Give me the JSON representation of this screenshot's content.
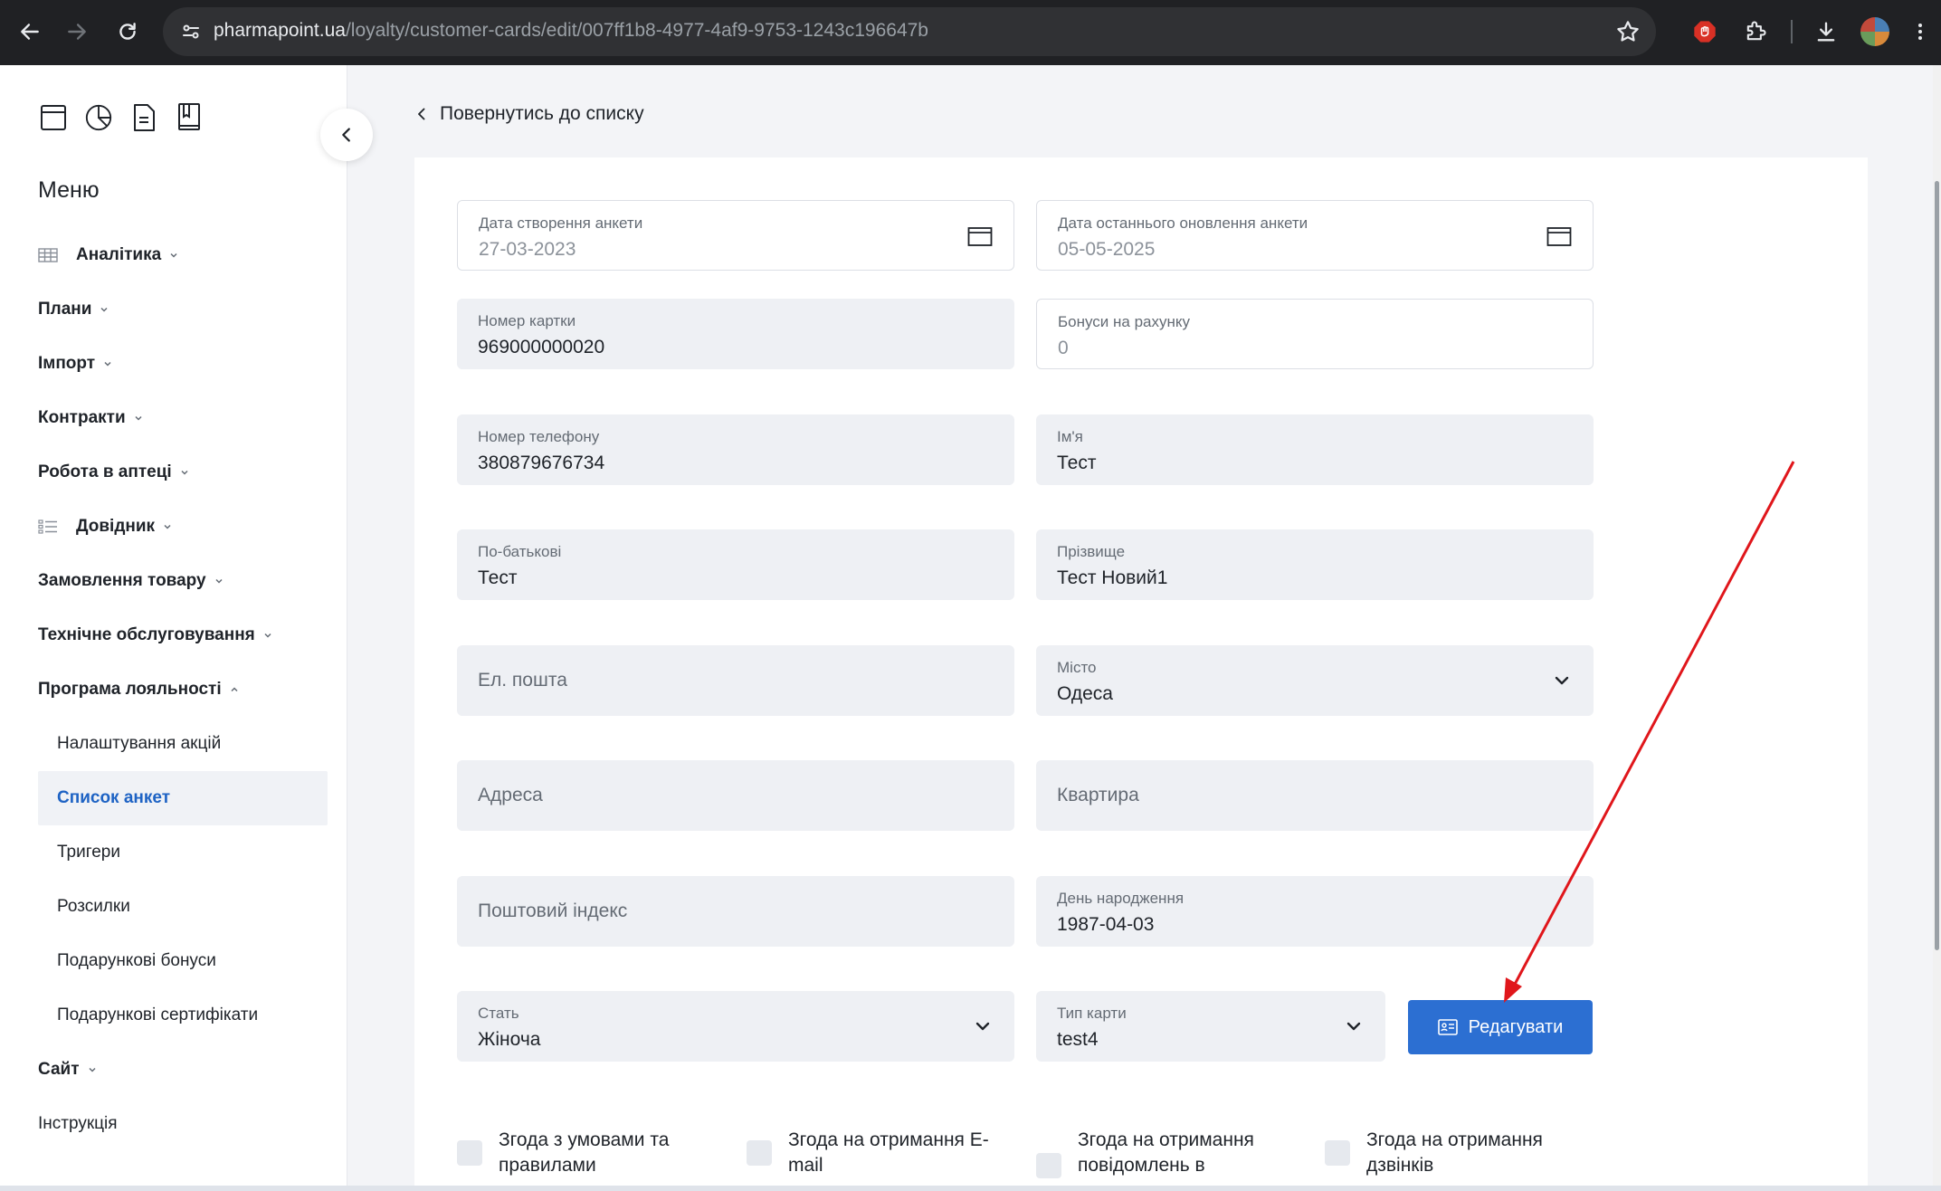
{
  "browser": {
    "url_host": "pharmapoint.ua",
    "url_path": "/loyalty/customer-cards/edit/007ff1b8-4977-4af9-9753-1243c196647b"
  },
  "sidebar": {
    "menu_title": "Меню",
    "top_icons": [
      "store-icon",
      "pie-chart-icon",
      "document-icon",
      "book-icon"
    ],
    "items": [
      {
        "label": "Аналітика",
        "icon": "grid-icon",
        "expanded": false
      },
      {
        "label": "Плани",
        "expanded": false
      },
      {
        "label": "Імпорт",
        "expanded": false
      },
      {
        "label": "Контракти",
        "expanded": false
      },
      {
        "label": "Робота в аптеці",
        "expanded": false
      },
      {
        "label": "Довідник",
        "icon": "list-icon",
        "expanded": false
      },
      {
        "label": "Замовлення товару",
        "expanded": false
      },
      {
        "label": "Технічне обслуговування",
        "expanded": false
      },
      {
        "label": "Програма лояльності",
        "expanded": true
      }
    ],
    "loyalty_sub": [
      {
        "label": "Налаштування акцій",
        "active": false
      },
      {
        "label": "Список анкет",
        "active": true
      },
      {
        "label": "Тригери",
        "active": false
      },
      {
        "label": "Розсилки",
        "active": false
      },
      {
        "label": "Подарункові бонуси",
        "active": false
      },
      {
        "label": "Подарункові сертифікати",
        "active": false
      }
    ],
    "after_items": [
      {
        "label": "Сайт",
        "expanded": false
      },
      {
        "label": "Інструкція"
      }
    ]
  },
  "main": {
    "back_label": "Повернутись до списку",
    "form": {
      "created_date": {
        "label": "Дата створення анкети",
        "value": "27-03-2023"
      },
      "updated_date": {
        "label": "Дата останнього оновлення анкети",
        "value": "05-05-2025"
      },
      "card_number": {
        "label": "Номер картки",
        "value": "969000000020"
      },
      "bonuses": {
        "label": "Бонуси на рахунку",
        "value": "0"
      },
      "phone": {
        "label": "Номер телефону",
        "value": "380879676734"
      },
      "first_name": {
        "label": "Ім'я",
        "value": "Тест"
      },
      "patronymic": {
        "label": "По-батькові",
        "value": "Тест"
      },
      "last_name": {
        "label": "Прізвище",
        "value": "Тест Новий1"
      },
      "email": {
        "placeholder": "Ел. пошта"
      },
      "city": {
        "label": "Місто",
        "value": "Одеса"
      },
      "address": {
        "placeholder": "Адреса"
      },
      "apartment": {
        "placeholder": "Квартира"
      },
      "postal_code": {
        "placeholder": "Поштовий індекс"
      },
      "birthday": {
        "label": "День народження",
        "value": "1987-04-03"
      },
      "gender": {
        "label": "Стать",
        "value": "Жіноча"
      },
      "card_type": {
        "label": "Тип карти",
        "value": "test4"
      },
      "edit_button": "Редагувати"
    },
    "consents": [
      {
        "label": "Згода з умовами та правилами"
      },
      {
        "label": "Згода на отримання E-mail"
      },
      {
        "label": "Згода на отримання повідомлень в"
      },
      {
        "label": "Згода на отримання дзвінків"
      }
    ]
  },
  "colors": {
    "accent": "#2c6fd2",
    "active_text": "#1e63c4",
    "annotation_arrow": "#e0161b"
  }
}
